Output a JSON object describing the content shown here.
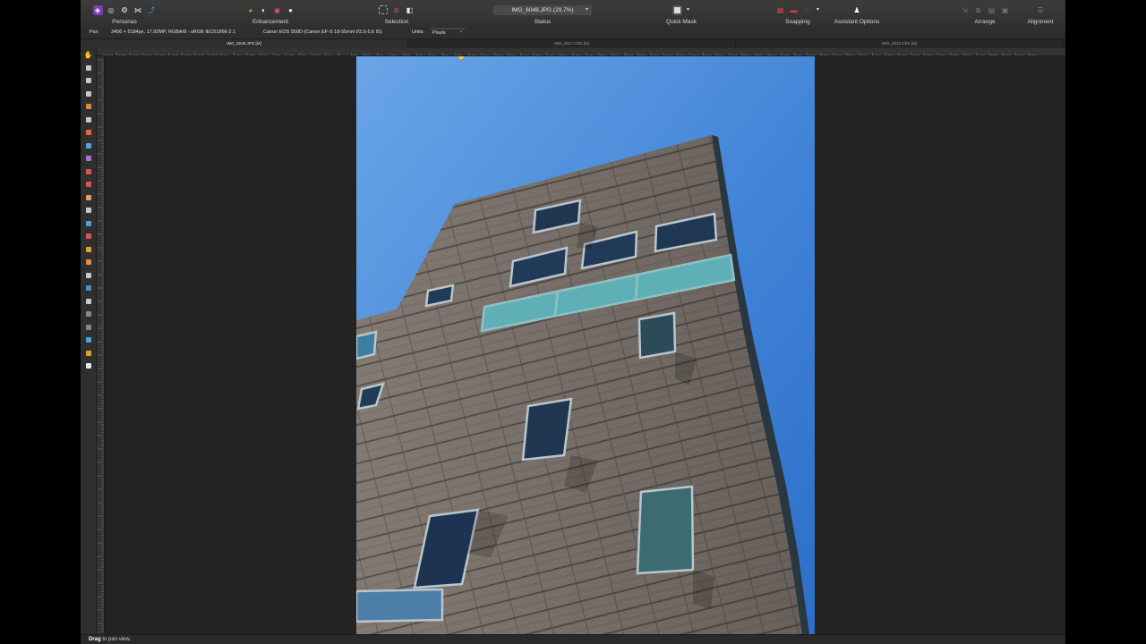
{
  "toolbar": {
    "personas_label": "Personas",
    "enhancement_label": "Enhancement",
    "selection_label": "Selection",
    "status_label": "Status",
    "status_doc": "IMG_6048.JPG (29.7%)",
    "quick_mask_label": "Quick Mask",
    "snapping_label": "Snapping",
    "assistant_label": "Assistant Options",
    "arrange_label": "Arrange",
    "alignment_label": "Alignment"
  },
  "context": {
    "tool_name": "Pan",
    "image_info": "3456 × 5184px, 17.92MP, RGBA/8 - sRGB IEC61966-2.1",
    "camera_info": "Canon EOS 550D (Canon EF-S 18-55mm f/3.5-5.6 IS)",
    "units_label": "Units:",
    "units_value": "Pixels"
  },
  "doc_tabs": [
    {
      "label": "IMG_6048.JPG [M]",
      "active": true
    },
    {
      "label": "IMG_0217.CR2 [M]",
      "active": false
    },
    {
      "label": "IMG_0310.CR2 [M]",
      "active": false
    }
  ],
  "ruler": {
    "labels": [
      "-1800",
      "-1700",
      "-1600",
      "-1500",
      "-1400",
      "-1300",
      "-1200",
      "-1100",
      "-1000",
      "-900",
      "-800",
      "-700",
      "-600",
      "-500",
      "-400",
      "-300",
      "-200",
      "-100",
      "0",
      "100",
      "200",
      "300",
      "400",
      "500",
      "600",
      "700",
      "800",
      "900",
      "1000",
      "1100",
      "1200",
      "1300",
      "1400",
      "1500",
      "1600",
      "1700",
      "1800",
      "1900",
      "2000",
      "2100",
      "2200",
      "2300",
      "2400",
      "2500",
      "2600",
      "2700",
      "2800",
      "2900",
      "3000",
      "3100",
      "3200",
      "3300",
      "3400",
      "3500",
      "3600",
      "3700",
      "3800",
      "3900",
      "4000",
      "4100",
      "4200",
      "4300",
      "4400",
      "4500",
      "4600",
      "4700",
      "4800",
      "4900",
      "5000",
      "5100",
      "5200",
      "5300"
    ]
  },
  "tools": [
    {
      "name": "hand-tool",
      "color": "#c8c8c8"
    },
    {
      "name": "move-tool",
      "color": "#c8c8c8"
    },
    {
      "name": "color-picker-tool",
      "color": "#c8c8c8"
    },
    {
      "name": "crop-tool",
      "color": "#c8c8c8"
    },
    {
      "name": "selection-brush-tool",
      "color": "#e08a3c"
    },
    {
      "name": "marquee-tool",
      "color": "#c8c8c8"
    },
    {
      "name": "freehand-selection-tool",
      "color": "#e06a3c"
    },
    {
      "name": "flood-fill-tool",
      "color": "#5aa0e0"
    },
    {
      "name": "gradient-tool",
      "color": "#b070d0"
    },
    {
      "name": "paint-brush-tool",
      "color": "#e05050"
    },
    {
      "name": "clone-tool",
      "color": "#e05050"
    },
    {
      "name": "erase-tool",
      "color": "#e0a060"
    },
    {
      "name": "dodge-tool",
      "color": "#c8c8c8"
    },
    {
      "name": "blur-tool",
      "color": "#50a0e0"
    },
    {
      "name": "smudge-tool",
      "color": "#e05050"
    },
    {
      "name": "red-eye-tool",
      "color": "#e0a030"
    },
    {
      "name": "healing-tool",
      "color": "#e09040"
    },
    {
      "name": "node-tool",
      "color": "#c8c8c8"
    },
    {
      "name": "shape-tool",
      "color": "#4a90d8"
    },
    {
      "name": "text-tool",
      "color": "#c8c8c8"
    },
    {
      "name": "mesh-warp-tool",
      "color": "#888888"
    },
    {
      "name": "inpainting-tool",
      "color": "#888888"
    },
    {
      "name": "zoom-tool",
      "color": "#50a0e0"
    },
    {
      "name": "fg-color-swatch",
      "color": "#e0a030"
    },
    {
      "name": "bg-color-swatch",
      "color": "#e8e8f0"
    }
  ],
  "statusbar": {
    "hint_bold": "Drag",
    "hint_rest": " to pan view."
  }
}
